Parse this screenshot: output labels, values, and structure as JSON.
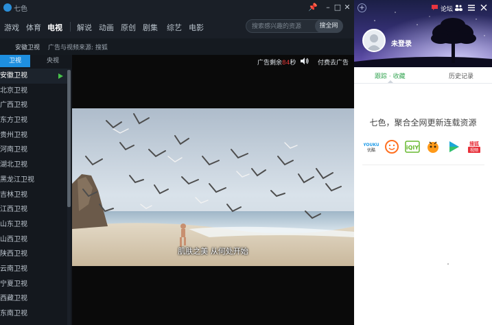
{
  "app": {
    "title": "七色"
  },
  "window_buttons": {
    "pin": "📌",
    "minimize": "–",
    "maximize": "□",
    "close": "✕"
  },
  "nav": {
    "items": [
      {
        "label": "游戏"
      },
      {
        "label": "体育"
      },
      {
        "label": "电视",
        "active": true
      },
      {
        "label": "解说"
      },
      {
        "label": "动画"
      },
      {
        "label": "原创"
      },
      {
        "label": "剧集"
      },
      {
        "label": "综艺"
      },
      {
        "label": "电影"
      }
    ]
  },
  "search": {
    "placeholder": "搜索感兴趣的资源",
    "button_label": "搜全网"
  },
  "infobar": {
    "channel_name": "安徽卫视",
    "ad_source": "广告与视频来源: 搜狐"
  },
  "channel_tabs": {
    "satellite": "卫视",
    "cctv": "央视"
  },
  "channels": [
    {
      "name": "安徽卫视",
      "active": true
    },
    {
      "name": "北京卫视"
    },
    {
      "name": "广西卫视"
    },
    {
      "name": "东方卫视"
    },
    {
      "name": "贵州卫视"
    },
    {
      "name": "河南卫视"
    },
    {
      "name": "湖北卫视"
    },
    {
      "name": "黑龙江卫视"
    },
    {
      "name": "吉林卫视"
    },
    {
      "name": "江西卫视"
    },
    {
      "name": "山东卫视"
    },
    {
      "name": "山西卫视"
    },
    {
      "name": "陕西卫视"
    },
    {
      "name": "云南卫视"
    },
    {
      "name": "宁夏卫视"
    },
    {
      "name": "西藏卫视"
    },
    {
      "name": "东南卫视"
    }
  ],
  "ad": {
    "remaining_prefix": "广告剩余",
    "seconds": "84",
    "unit": "秒",
    "skip_label": "付费去广告"
  },
  "video": {
    "subtitle": "肌肤之美 从何处开始"
  },
  "side": {
    "forum_label": "论坛",
    "login_status": "未登录",
    "tabs": {
      "follow": "跟踪 · 收藏",
      "history": "历史记录"
    },
    "promo_text": "七色，聚合全网更新连载资源",
    "sites": [
      {
        "name": "优酷",
        "color": "#1e9be8"
      },
      {
        "name": "土豆",
        "color": "#ff6f1f"
      },
      {
        "name": "爱奇艺",
        "color": "#66b82e"
      },
      {
        "name": "芒果",
        "color": "#ff9a1a"
      },
      {
        "name": "PPTV",
        "color": "#1ba7d8"
      },
      {
        "name": "搜狐视频",
        "color": "#e8313b"
      }
    ]
  }
}
